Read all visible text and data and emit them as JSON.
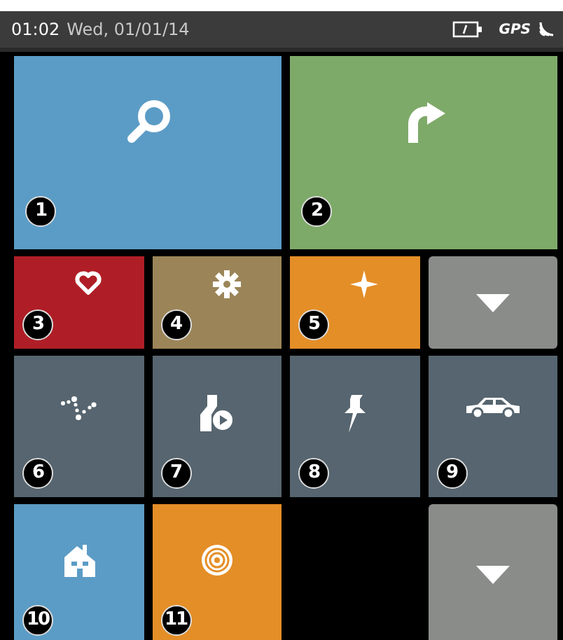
{
  "status_bar": {
    "time": "01:02",
    "date": "Wed, 01/01/14",
    "gps": "GPS"
  },
  "rows": [
    {
      "tiles": [
        {
          "kind": "feature",
          "number": "1",
          "color": "#5b9cc6"
        },
        {
          "kind": "feature",
          "number": "2",
          "color": "#7eaa69"
        }
      ]
    },
    {
      "tiles": [
        {
          "kind": "feature",
          "number": "3",
          "color": "#af1e26"
        },
        {
          "kind": "feature",
          "number": "4",
          "color": "#9b8558"
        },
        {
          "kind": "feature",
          "number": "5",
          "color": "#e48e27"
        },
        {
          "kind": "more"
        }
      ]
    },
    {
      "tiles": [
        {
          "kind": "feature",
          "number": "6",
          "color": "#56656f"
        },
        {
          "kind": "feature",
          "number": "7",
          "color": "#56656f"
        },
        {
          "kind": "feature",
          "number": "8",
          "color": "#56656f"
        },
        {
          "kind": "feature",
          "number": "9",
          "color": "#56656f"
        }
      ]
    },
    {
      "tiles": [
        {
          "kind": "feature",
          "number": "10",
          "color": "#5b9cc6"
        },
        {
          "kind": "feature",
          "number": "11",
          "color": "#e48e27"
        },
        {
          "kind": "empty"
        },
        {
          "kind": "more"
        }
      ]
    }
  ]
}
